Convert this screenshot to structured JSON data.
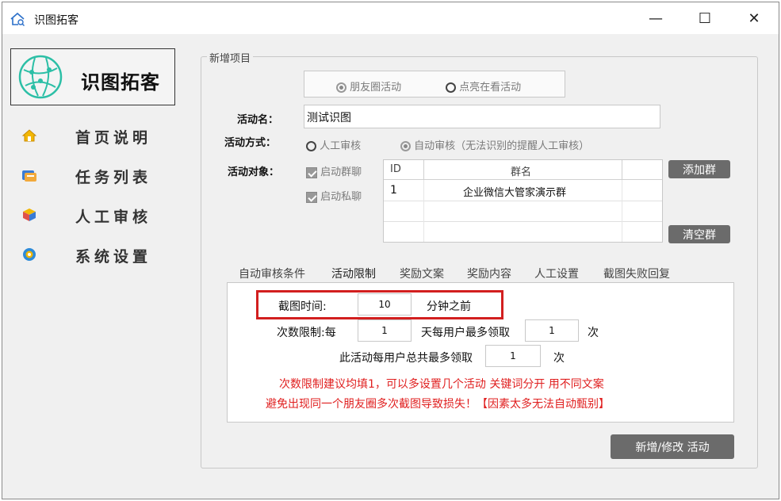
{
  "window": {
    "title": "识图拓客",
    "minimize": "—",
    "maximize": "☐",
    "close": "✕"
  },
  "sidebar": {
    "logo_text": "识图拓客",
    "items": [
      {
        "label": "首页说明",
        "icon": "home-icon"
      },
      {
        "label": "任务列表",
        "icon": "task-list-icon"
      },
      {
        "label": "人工审核",
        "icon": "review-icon"
      },
      {
        "label": "系统设置",
        "icon": "settings-gear-icon"
      }
    ]
  },
  "form": {
    "group_title": "新增项目",
    "type_options": [
      "朋友圈活动",
      "点亮在看活动"
    ],
    "activity_name_label": "活动名：",
    "activity_name_value": "测试识图",
    "mode_label": "活动方式：",
    "mode_options": [
      "人工审核",
      "自动审核（无法识别的提醒人工审核）"
    ],
    "target_label": "活动对象：",
    "target_checks": [
      "启动群聊",
      "启动私聊"
    ],
    "group_table": {
      "columns": [
        "ID",
        "群名"
      ],
      "rows": [
        {
          "id": "1",
          "name": "企业微信大管家演示群"
        }
      ]
    },
    "add_group_button": "添加群",
    "clear_group_button": "清空群"
  },
  "tabs": [
    "自动审核条件",
    "活动限制",
    "奖励文案",
    "奖励内容",
    "人工设置",
    "截图失败回复"
  ],
  "active_tab": "活动限制",
  "limits": {
    "screenshot_label": "截图时间:",
    "screenshot_value": "10",
    "screenshot_unit": "分钟之前",
    "count_label": "次数限制:每",
    "daily_days_value": "1",
    "daily_mid": "天每用户最多领取",
    "daily_times_value": "1",
    "times_unit": "次",
    "total_label": "此活动每用户总共最多领取",
    "total_value": "1",
    "total_unit": "次",
    "warning_line1": "次数限制建议均填1，可以多设置几个活动 关键词分开 用不同文案",
    "warning_line2": "避免出现同一个朋友圈多次截图导致损失！【因素太多无法自动甄别】"
  },
  "submit_button": "新增/修改 活动",
  "colors": {
    "warning": "#e02020",
    "highlight_border": "#d21f1f",
    "active_tab_underline": "#3c8fd8",
    "button_gray": "#6b6b6b",
    "logo_teal": "#2cbfa6"
  }
}
